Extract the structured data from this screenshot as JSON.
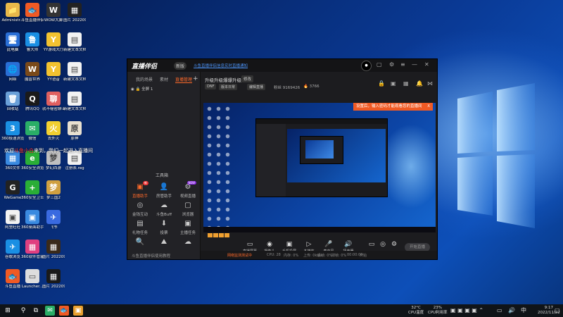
{
  "desktop": {
    "icons": [
      {
        "label": "Administr...",
        "glyph": "📁",
        "bg": "#e8b84a",
        "col": 0,
        "row": 0
      },
      {
        "label": "斗鱼直播伴侣",
        "glyph": "🐟",
        "bg": "#f05a24",
        "col": 1,
        "row": 0
      },
      {
        "label": "WOW大脚",
        "glyph": "W",
        "bg": "#333333",
        "col": 2,
        "row": 0
      },
      {
        "label": "图片 20220916...",
        "glyph": "▦",
        "bg": "#222222",
        "col": 3,
        "row": 0
      },
      {
        "label": "此电脑",
        "glyph": "🖥",
        "bg": "#2a6fd6",
        "col": 0,
        "row": 1
      },
      {
        "label": "鲁大师",
        "glyph": "鲁",
        "bg": "#1a8fe3",
        "col": 1,
        "row": 1
      },
      {
        "label": "YY游戏大厅",
        "glyph": "Y",
        "bg": "#f2c230",
        "col": 2,
        "row": 1
      },
      {
        "label": "新建文本文档 (2)",
        "glyph": "▤",
        "bg": "#f2f2f2",
        "col": 3,
        "row": 1
      },
      {
        "label": "网络",
        "glyph": "🌐",
        "bg": "#2a6fd6",
        "col": 0,
        "row": 2
      },
      {
        "label": "魔兽世界",
        "glyph": "W",
        "bg": "#7a4a1a",
        "col": 1,
        "row": 2
      },
      {
        "label": "YY语音",
        "glyph": "Y",
        "bg": "#f2c230",
        "col": 2,
        "row": 2
      },
      {
        "label": "新建文本文档 (3)",
        "glyph": "▤",
        "bg": "#f2f2f2",
        "col": 3,
        "row": 2
      },
      {
        "label": "回收站",
        "glyph": "🗑",
        "bg": "#6aa0d8",
        "col": 0,
        "row": 3
      },
      {
        "label": "腾讯QQ",
        "glyph": "Q",
        "bg": "#1a1a1a",
        "col": 1,
        "row": 3
      },
      {
        "label": "就不秘密聊士",
        "glyph": "聊",
        "bg": "#e06060",
        "col": 2,
        "row": 3
      },
      {
        "label": "新建文本文档",
        "glyph": "▤",
        "bg": "#f2f2f2",
        "col": 3,
        "row": 3
      },
      {
        "label": "360极速浏览器",
        "glyph": "3",
        "bg": "#1a8fe3",
        "col": 0,
        "row": 4
      },
      {
        "label": "微信",
        "glyph": "✉",
        "bg": "#2aae67",
        "col": 1,
        "row": 4
      },
      {
        "label": "去外火",
        "glyph": "火",
        "bg": "#f2d030",
        "col": 2,
        "row": 4
      },
      {
        "label": "原神",
        "glyph": "原",
        "bg": "#e8e0d0",
        "col": 3,
        "row": 4
      },
      {
        "label": "360文件",
        "glyph": "▦",
        "bg": "#3a8ae0",
        "col": 0,
        "row": 5
      },
      {
        "label": "360安全浏览器",
        "glyph": "e",
        "bg": "#2aae37",
        "col": 1,
        "row": 5
      },
      {
        "label": "梦幻西游",
        "glyph": "梦",
        "bg": "#c0c0c0",
        "col": 2,
        "row": 5
      },
      {
        "label": "注册表.reg",
        "glyph": "▤",
        "bg": "#f2f2f2",
        "col": 3,
        "row": 5
      },
      {
        "label": "WeGame",
        "glyph": "G",
        "bg": "#222222",
        "col": 0,
        "row": 6
      },
      {
        "label": "360安全卫士",
        "glyph": "+",
        "bg": "#2aae37",
        "col": 1,
        "row": 6
      },
      {
        "label": "梦三国2",
        "glyph": "梦",
        "bg": "#d0a040",
        "col": 2,
        "row": 6
      },
      {
        "label": "阿里旺旺",
        "glyph": "▣",
        "bg": "#f2f2f2",
        "col": 0,
        "row": 7
      },
      {
        "label": "360桌面助手",
        "glyph": "▣",
        "bg": "#3a8ae0",
        "col": 1,
        "row": 7
      },
      {
        "label": "飞书",
        "glyph": "✈",
        "bg": "#3a6ae0",
        "col": 2,
        "row": 7
      },
      {
        "label": "谷歌浏览",
        "glyph": "✈",
        "bg": "#1a8fe3",
        "col": 0,
        "row": 8
      },
      {
        "label": "360软件管家",
        "glyph": "▦",
        "bg": "#e04080",
        "col": 1,
        "row": 8
      },
      {
        "label": "图片 20220916...",
        "glyph": "▦",
        "bg": "#3a2a1a",
        "col": 2,
        "row": 8
      },
      {
        "label": "斗鱼直播",
        "glyph": "🐟",
        "bg": "#f05a24",
        "col": 0,
        "row": 9
      },
      {
        "label": "Launcher...",
        "glyph": "▭",
        "bg": "#dddddd",
        "col": 1,
        "row": 9
      },
      {
        "label": "图片 20220916...",
        "glyph": "▦",
        "bg": "#1a1a1a",
        "col": 2,
        "row": 9
      }
    ],
    "welcome_pre": "欢迎",
    "welcome_name": "斗鱼小白",
    "welcome_post": "来到，我们一起进入直播间"
  },
  "app": {
    "logo": "直播伴侣",
    "version": "新版",
    "notice": "斗鱼直播伴侣信息实时直播通知",
    "left_tabs": [
      "我的场景",
      "素材",
      "直播管理"
    ],
    "active_tab_index": 2,
    "scene_label": "全屏 1",
    "tools_title": "工具箱",
    "tools": [
      {
        "label": "直播助手",
        "icon": "▣",
        "hot": true,
        "badge": "新",
        "badge_color": "red"
      },
      {
        "label": "房管助手",
        "icon": "👤",
        "hot": false,
        "badge": "",
        "badge_color": ""
      },
      {
        "label": "视频直播",
        "icon": "⚙",
        "hot": false,
        "badge": "NEW",
        "badge_color": "purple"
      },
      {
        "label": "金钱互动",
        "icon": "◎",
        "hot": false,
        "badge": "",
        "badge_color": ""
      },
      {
        "label": "斗鱼Buff",
        "icon": "☁",
        "hot": false,
        "badge": "",
        "badge_color": ""
      },
      {
        "label": "浏览器",
        "icon": "▢",
        "hot": false,
        "badge": "",
        "badge_color": ""
      },
      {
        "label": "礼物任务",
        "icon": "▤",
        "hot": false,
        "badge": "",
        "badge_color": ""
      },
      {
        "label": "投票",
        "icon": "⬇",
        "hot": false,
        "badge": "",
        "badge_color": ""
      },
      {
        "label": "主播任务",
        "icon": "▣",
        "hot": false,
        "badge": "",
        "badge_color": ""
      },
      {
        "label": "",
        "icon": "🔍",
        "hot": false,
        "badge": "",
        "badge_color": ""
      },
      {
        "label": "",
        "icon": "⛰",
        "hot": false,
        "badge": "",
        "badge_color": ""
      },
      {
        "label": "",
        "icon": "☁",
        "hot": false,
        "badge": "",
        "badge_color": ""
      }
    ],
    "left_footer": "斗鱼直播伴侣使用教程",
    "room_title": "升级升级爆爆升级",
    "room_edit": "修改",
    "tags": [
      "DNF",
      "版本日常",
      "编辑直播"
    ],
    "stat_fans_label": "粉丝",
    "stat_fans": "9169426",
    "stat_hot_icon": "🔥",
    "stat_hot": "3766",
    "toast": "设置后，输入密码才能观看您的直播间",
    "toast_close": "X",
    "controls": [
      {
        "label": "直播屏幕",
        "icon": "▭"
      },
      {
        "label": "摄像头",
        "icon": "◉"
      },
      {
        "label": "手机投屏",
        "icon": "▣"
      },
      {
        "label": "多媒体",
        "icon": "▷"
      },
      {
        "label": "麦克风",
        "icon": "🎤"
      },
      {
        "label": "扬声器",
        "icon": "🔊"
      }
    ],
    "live_button": "开始直播",
    "status": [
      {
        "text": "网络监测测试中",
        "warn": true
      },
      {
        "text": "CPU: 28",
        "warn": false
      },
      {
        "text": "内存: 0%",
        "warn": false
      },
      {
        "text": "上传: 0kb/s",
        "warn": false
      },
      {
        "text": "丢帧: 0%",
        "warn": false
      },
      {
        "text": "掉帧: 0%",
        "warn": false
      },
      {
        "text": "00:00:00",
        "warn": false
      },
      {
        "text": "开始",
        "warn": false
      }
    ]
  },
  "taskbar": {
    "start_icon": "⊞",
    "search_icon": "⚲",
    "taskview_icon": "⧉",
    "apps": [
      {
        "name": "wechat-taskbar-icon",
        "glyph": "✉",
        "bg": "#2aae67"
      },
      {
        "name": "douyu-taskbar-icon",
        "glyph": "🐟",
        "bg": "#f05a24"
      },
      {
        "name": "app-taskbar-icon",
        "glyph": "▣",
        "bg": "#e8a030"
      }
    ],
    "cpu_temp": "32°C",
    "cpu_label": "CPU温度",
    "cpu_usage": "23%",
    "cpu_usage_label": "CPU利用率",
    "ime": "中",
    "time": "9:17",
    "date": "2022/11/22"
  }
}
